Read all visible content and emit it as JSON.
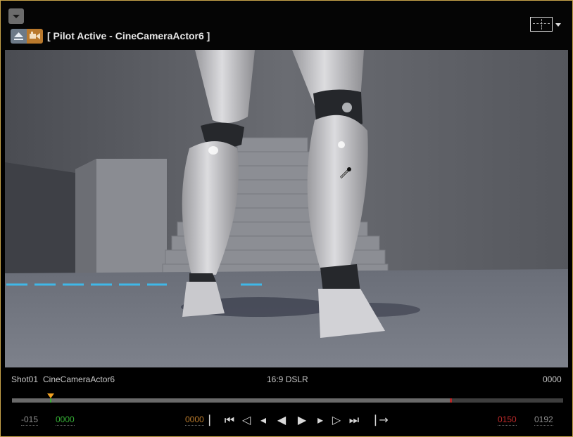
{
  "header": {
    "pilot_text": "[ Pilot Active - CineCameraActor6 ]",
    "icons": [
      "dropdown-icon",
      "eject-icon",
      "pilot-camera-icon",
      "layout-grid-icon"
    ]
  },
  "info": {
    "shot": "Shot01",
    "camera": "CineCameraActor6",
    "filmback": "16:9 DSLR",
    "frame": "0000"
  },
  "timeline": {
    "start_outer": "-015",
    "start": "0000",
    "current": "0000",
    "end": "0150",
    "end_outer": "0192",
    "playhead_fraction": 0.07,
    "playrange_end_fraction": 0.795
  },
  "transport": {
    "buttons": [
      {
        "name": "jump-to-start-button",
        "icon": "jump-start-icon",
        "glyph": "⎸"
      },
      {
        "name": "step-back-key-button",
        "icon": "step-back-key-icon",
        "glyph": "⏮"
      },
      {
        "name": "prev-key-button",
        "icon": "prev-key-icon",
        "glyph": "◁"
      },
      {
        "name": "step-back-frame-button",
        "icon": "step-back-frame-icon",
        "glyph": "◂"
      },
      {
        "name": "play-reverse-button",
        "icon": "play-reverse-icon",
        "glyph": "◀"
      },
      {
        "name": "play-button",
        "icon": "play-icon",
        "glyph": "▶"
      },
      {
        "name": "step-forward-frame-button",
        "icon": "step-forward-frame-icon",
        "glyph": "▸"
      },
      {
        "name": "next-key-button",
        "icon": "next-key-icon",
        "glyph": "▷"
      },
      {
        "name": "step-forward-key-button",
        "icon": "step-forward-key-icon",
        "glyph": "⏭"
      },
      {
        "name": "jump-to-end-button",
        "icon": "jump-end-icon",
        "glyph": "⎹"
      },
      {
        "name": "loop-mode-button",
        "icon": "arrow-right-icon",
        "glyph": "→"
      }
    ]
  },
  "colors": {
    "border": "#c9a54b",
    "start_green": "#35b035",
    "end_red": "#c02a2a",
    "current_orange": "#b97a2b",
    "playhead": "#f0a020"
  }
}
